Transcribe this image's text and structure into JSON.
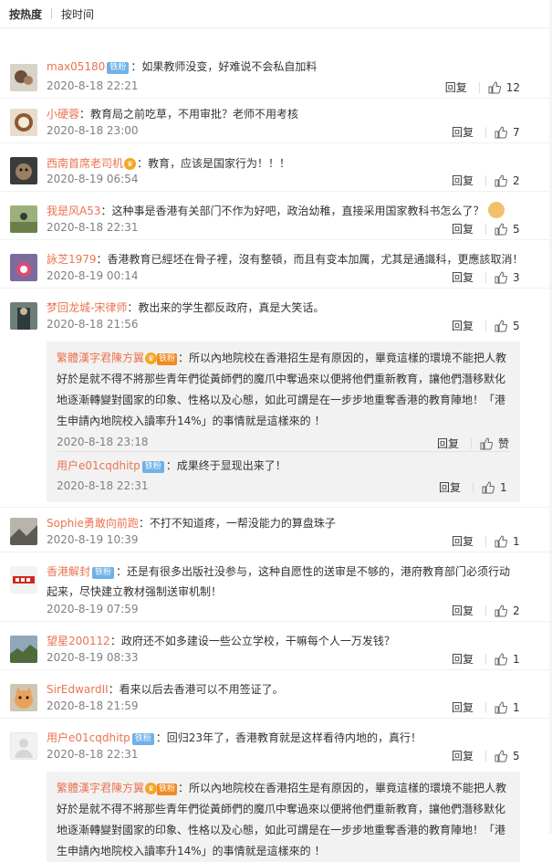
{
  "tabs": {
    "hot": "按热度",
    "time": "按时间"
  },
  "labels": {
    "reply": "回复",
    "zan": "赞"
  },
  "comments": [
    {
      "user": "max05180",
      "badge": "铁粉",
      "text": "：如果教师没变，好难说不会私自加料",
      "time": "2020-8-18 22:21",
      "likes": "12"
    },
    {
      "user": "小硬蓉",
      "text": "：教育局之前吃草，不用审批？老师不用考核",
      "time": "2020-8-18 23:00",
      "likes": "7"
    },
    {
      "user": "西南首席老司机",
      "text": "：教育，应该是国家行为！！！",
      "time": "2020-8-19 06:54",
      "likes": "2"
    },
    {
      "user": "我是风A53",
      "text": "：这种事是香港有关部门不作为好吧，政治幼稚，直接采用国家教科书怎么了？",
      "time": "2020-8-18 22:31",
      "likes": "5"
    },
    {
      "user": "詠芝1979",
      "text": "：香港教育已經坯在骨子裡，沒有整頓，而且有变本加厲，尤其是通識科，更應該取消！",
      "time": "2020-8-19 00:14",
      "likes": "3"
    },
    {
      "user": "梦回龙城-宋律师",
      "text": "：教出来的学生都反政府，真是大笑话。",
      "time": "2020-8-18 21:56",
      "likes": "5"
    },
    {
      "user": "Sophie勇敢向前跑",
      "text": "：不打不知道疼，一帮没能力的算盘珠子",
      "time": "2020-8-19 10:39",
      "likes": "1"
    },
    {
      "user": "香港解封",
      "badge": "铁粉",
      "text": "：还是有很多出版社没参与，这种自愿性的送审是不够的，港府教育部门必须行动",
      "text2": "起来，尽快建立教材强制送审机制！",
      "time": "2020-8-19 07:59",
      "likes": "2"
    },
    {
      "user": "望星200112",
      "text": "：政府还不如多建设一些公立学校，干嘛每个人一万发钱？",
      "time": "2020-8-19 08:33",
      "likes": "1"
    },
    {
      "user": "SirEdwardII",
      "text": "：看来以后去香港可以不用签证了。",
      "time": "2020-8-18 21:59",
      "likes": "1"
    },
    {
      "user": "用户e01cqdhitp",
      "badge": "铁粉",
      "text": "：回归23年了，香港教育就是这样看待内地的，真行！",
      "time": "2020-8-18 22:31",
      "likes": "5"
    }
  ],
  "subs": [
    {
      "user": "繁體漢字君陳方翼",
      "badge": "铁粉",
      "lines": [
        "：所以內地院校在香港招生是有原因的，畢竟這樣的環境不能把人教",
        "好於是就不得不將那些青年們從黃師們的魔爪中奪過來以便將他們重新教育，讓他們潛移默化",
        "地逐漸轉變對國家的印象、性格以及心態，如此可謂是在一步步地重奪香港的教育陣地！「港",
        "生申請內地院校入讀率升14%」的事情就是這樣來的 ！"
      ],
      "time": "2020-8-18 23:18",
      "likes": "赞"
    },
    {
      "user": "用户e01cqdhitp",
      "badge": "铁粉",
      "lines": [
        "：成果终于显现出来了！"
      ],
      "time": "2020-8-18 22:31",
      "likes": "1"
    },
    {
      "user": "繁體漢字君陳方翼",
      "badge": "铁粉",
      "lines": [
        "：所以內地院校在香港招生是有原因的，畢竟這樣的環境不能把人教",
        "好於是就不得不將那些青年們從黃師們的魔爪中奪過來以便將他們重新教育，讓他們潛移默化",
        "地逐漸轉變對國家的印象、性格以及心態，如此可謂是在一步步地重奪香港的教育陣地！「港",
        "生申請內地院校入讀率升14%」的事情就是這樣來的 ！"
      ]
    }
  ]
}
